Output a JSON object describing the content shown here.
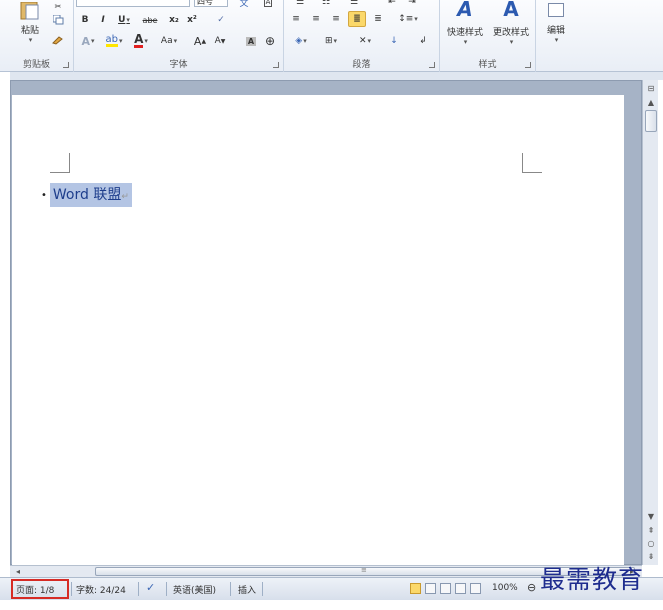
{
  "ribbon": {
    "clipboard": {
      "label": "剪贴板",
      "paste_label": "粘贴"
    },
    "font": {
      "label": "字体",
      "size_value": "四号",
      "bold": "B",
      "italic": "I",
      "underline": "U",
      "strike": "abe",
      "subscript": "x₂",
      "superscript": "x²",
      "font_color": "A",
      "change_case": "Aa",
      "grow": "A",
      "shrink": "A"
    },
    "paragraph": {
      "label": "段落"
    },
    "styles": {
      "label": "样式",
      "quick_styles": "快速样式",
      "change_styles": "更改样式"
    },
    "editing": {
      "label": "编辑"
    }
  },
  "document": {
    "text": "Word 联盟",
    "bullet": "•",
    "para_mark": "↵"
  },
  "status": {
    "page": "页面: 1/8",
    "words": "字数: 24/24",
    "language": "英语(美国)",
    "mode": "插入",
    "zoom": "100%"
  },
  "watermark": "最需教育",
  "colors": {
    "highlight": "#b4c5e4",
    "text": "#1e3e8c",
    "status_box": "#d62b25",
    "watermark": "#1e2c8e"
  }
}
